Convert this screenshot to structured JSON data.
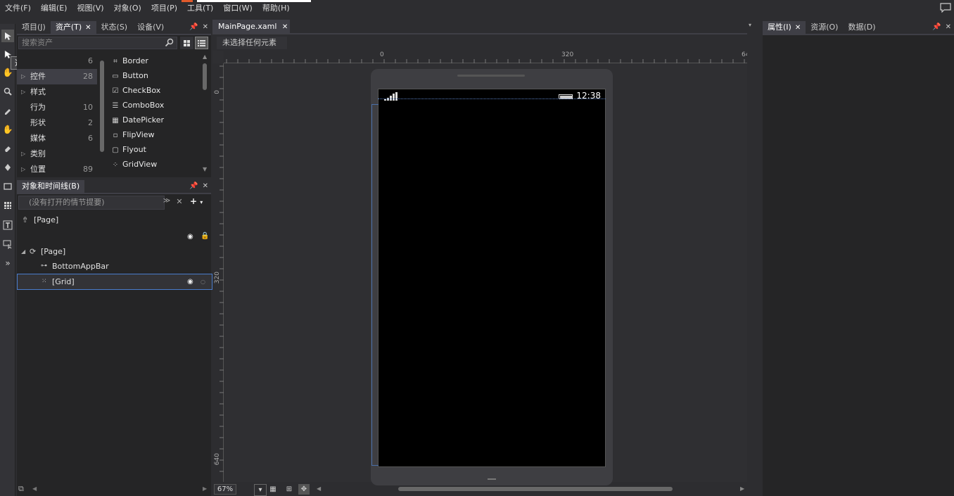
{
  "menu": [
    "文件(F)",
    "编辑(E)",
    "视图(V)",
    "对象(O)",
    "项目(P)",
    "工具(T)",
    "窗口(W)",
    "帮助(H)"
  ],
  "tooltip": "选择 (V)",
  "assets_panel": {
    "tabs": [
      {
        "label": "项目(J)",
        "closable": false,
        "active": false
      },
      {
        "label": "资产(T)",
        "closable": true,
        "active": true
      },
      {
        "label": "状态(S)",
        "closable": false,
        "active": false
      },
      {
        "label": "设备(V)",
        "closable": false,
        "active": false
      }
    ],
    "search_placeholder": "搜索资产",
    "categories": [
      {
        "name": "",
        "count": "6",
        "expandable": false,
        "selected": false
      },
      {
        "name": "控件",
        "count": "28",
        "expandable": true,
        "selected": true
      },
      {
        "name": "样式",
        "count": "",
        "expandable": true,
        "selected": false
      },
      {
        "name": "行为",
        "count": "10",
        "expandable": false,
        "selected": false
      },
      {
        "name": "形状",
        "count": "2",
        "expandable": false,
        "selected": false
      },
      {
        "name": "媒体",
        "count": "6",
        "expandable": false,
        "selected": false
      },
      {
        "name": "类别",
        "count": "",
        "expandable": true,
        "selected": false
      },
      {
        "name": "位置",
        "count": "89",
        "expandable": true,
        "selected": false
      }
    ],
    "items": [
      {
        "label": "Border",
        "icon": "border-icon"
      },
      {
        "label": "Button",
        "icon": "button-icon"
      },
      {
        "label": "CheckBox",
        "icon": "checkbox-icon"
      },
      {
        "label": "ComboBox",
        "icon": "combobox-icon"
      },
      {
        "label": "DatePicker",
        "icon": "datepicker-icon"
      },
      {
        "label": "FlipView",
        "icon": "flipview-icon"
      },
      {
        "label": "Flyout",
        "icon": "flyout-icon"
      },
      {
        "label": "GridView",
        "icon": "gridview-icon"
      }
    ]
  },
  "objects_panel": {
    "title": "对象和时间线(B)",
    "storyboard_placeholder": "(没有打开的情节提要)",
    "root_label": "[Page]",
    "tree": [
      {
        "label": "[Page]",
        "depth": 0,
        "selected": false
      },
      {
        "label": "BottomAppBar",
        "depth": 1,
        "selected": false
      },
      {
        "label": "[Grid]",
        "depth": 1,
        "selected": true
      }
    ]
  },
  "document": {
    "tab_label": "MainPage.xaml",
    "breadcrumb": "未选择任何元素",
    "ruler_top": [
      "0",
      "320",
      "64"
    ],
    "ruler_left": [
      "0",
      "320",
      "640"
    ],
    "zoom": "67%",
    "status_time": "12:38"
  },
  "right_panel": {
    "tabs": [
      {
        "label": "属性(I)",
        "closable": true,
        "active": true
      },
      {
        "label": "资源(O)",
        "closable": false,
        "active": false
      },
      {
        "label": "数据(D)",
        "closable": false,
        "active": false
      }
    ]
  },
  "colors": {
    "background": "#2d2d30",
    "panel": "#252526",
    "accent_blue": "#4a7ccc",
    "menu_accent": "#e05a2b"
  }
}
